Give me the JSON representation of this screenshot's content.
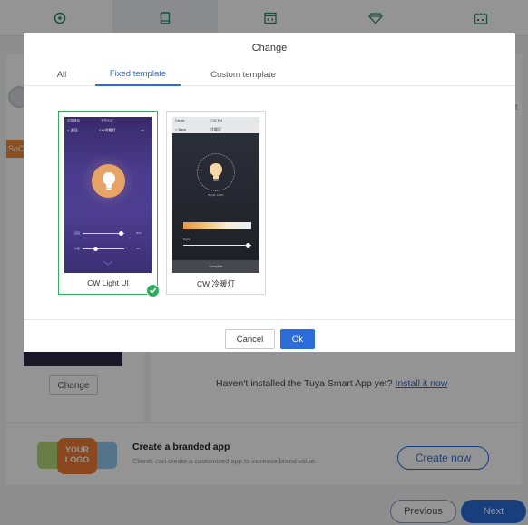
{
  "background": {
    "top_tabs": [
      {
        "icon": "palette-icon"
      },
      {
        "icon": "phone-icon"
      },
      {
        "icon": "code-window-icon"
      },
      {
        "icon": "diamond-icon"
      },
      {
        "icon": "factory-icon"
      }
    ],
    "edge_text_left": "SoC",
    "edge_text_right": "ert",
    "change_button": "Change",
    "install_prompt": "Haven't installed the Tuya Smart App yet?",
    "install_link": "Install it now",
    "branded_logo_text": "YOUR LOGO",
    "branded_title": "Create a branded app",
    "branded_desc": "Clients can create a customized app to increase brand value.",
    "create_now": "Create now",
    "previous": "Previous",
    "next": "Next"
  },
  "modal": {
    "title": "Change",
    "tabs": [
      {
        "label": "All",
        "active": false
      },
      {
        "label": "Fixed template",
        "active": true
      },
      {
        "label": "Custom template",
        "active": false
      }
    ],
    "templates": [
      {
        "name": "CW Light UI",
        "selected": true,
        "phone": {
          "status_left": "中国移动",
          "status_time": "下午3:07",
          "nav_back": "< 返回",
          "nav_title": "CW冷暖灯",
          "nav_more": "•••",
          "slider1_left": "亮度",
          "slider1_right": "80%",
          "slider2_left": "冷暖",
          "slider2_right": "0%"
        }
      },
      {
        "name": "CW 冷暖灯",
        "selected": false,
        "phone": {
          "status_left": "Carrier",
          "status_time": "7:52 PM",
          "nav_back": "< Back",
          "nav_title": "冷暖灯",
          "brightness_label": "Bright: 100%",
          "bright_small": "Bright",
          "bottom": "Complete"
        }
      }
    ],
    "cancel": "Cancel",
    "ok": "Ok"
  },
  "colors": {
    "accent": "#2a6cd8",
    "selected": "#2fae5f",
    "bulb": "#e7a466"
  }
}
